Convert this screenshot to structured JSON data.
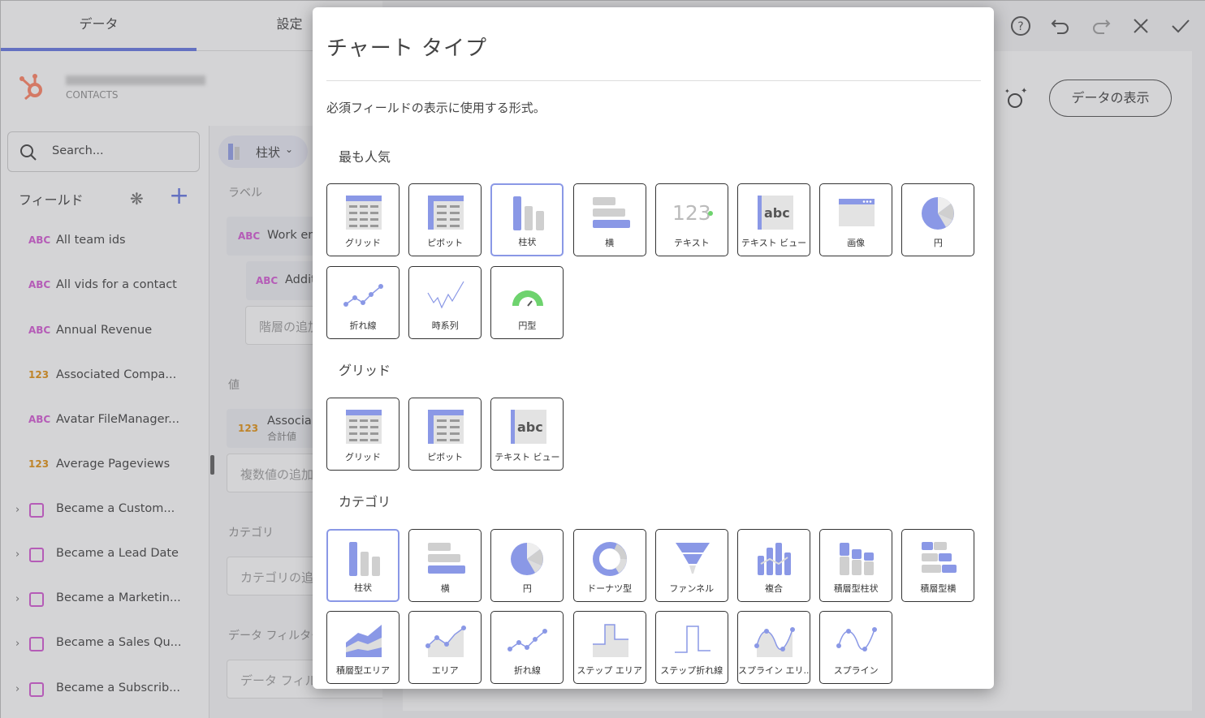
{
  "tabs": [
    "データ",
    "設定"
  ],
  "source": {
    "name": "CONTACTS",
    "brand_color": "#ff7a59"
  },
  "search": {
    "placeholder": "Search..."
  },
  "fields_header": "フィールド",
  "fields": [
    {
      "type": "ABC",
      "label": "All team ids"
    },
    {
      "type": "ABC",
      "label": "All vids for a contact"
    },
    {
      "type": "ABC",
      "label": "Annual Revenue"
    },
    {
      "type": "123",
      "label": "Associated Compa..."
    },
    {
      "type": "ABC",
      "label": "Avatar FileManager..."
    },
    {
      "type": "123",
      "label": "Average Pageviews"
    },
    {
      "type": "date",
      "label": "Became a Custom..."
    },
    {
      "type": "date",
      "label": "Became a Lead Date"
    },
    {
      "type": "date",
      "label": "Became a Marketin..."
    },
    {
      "type": "date",
      "label": "Became a Sales Qu..."
    },
    {
      "type": "date",
      "label": "Became a Subscrib..."
    }
  ],
  "middle": {
    "chart_type_label": "柱状",
    "label_header": "ラベル",
    "label_item_1": "Work em",
    "label_item_2": "Additi",
    "add_hierarchy": "階層の追加",
    "values_header": "値",
    "value_item": "Associa",
    "value_item_sub": "合計値",
    "add_values": "複数値の追加",
    "category_header": "カテゴリ",
    "add_category": "カテゴリの追加",
    "filter_header": "データ フィルター",
    "add_filter": "データ フィル"
  },
  "toolbar": {
    "show_data": "データの表示"
  },
  "modal": {
    "title": "チャート タイプ",
    "description": "必須フィールドの表示に使用する形式。",
    "sections": [
      {
        "title": "最も人気",
        "items": [
          "グリッド",
          "ピボット",
          "柱状",
          "横",
          "テキスト",
          "テキスト ビュー",
          "画像",
          "円",
          "折れ線",
          "時系列",
          "円型"
        ]
      },
      {
        "title": "グリッド",
        "items": [
          "グリッド",
          "ピボット",
          "テキスト ビュー"
        ]
      },
      {
        "title": "カテゴリ",
        "items": [
          "柱状",
          "横",
          "円",
          "ドーナツ型",
          "ファンネル",
          "複合",
          "積層型柱状",
          "積層型横",
          "積層型エリア",
          "エリア",
          "折れ線",
          "ステップ エリア",
          "ステップ折れ線",
          "スプライン エリ...",
          "スプライン"
        ]
      }
    ],
    "selected": "柱状",
    "accent": "#8a98e6"
  }
}
